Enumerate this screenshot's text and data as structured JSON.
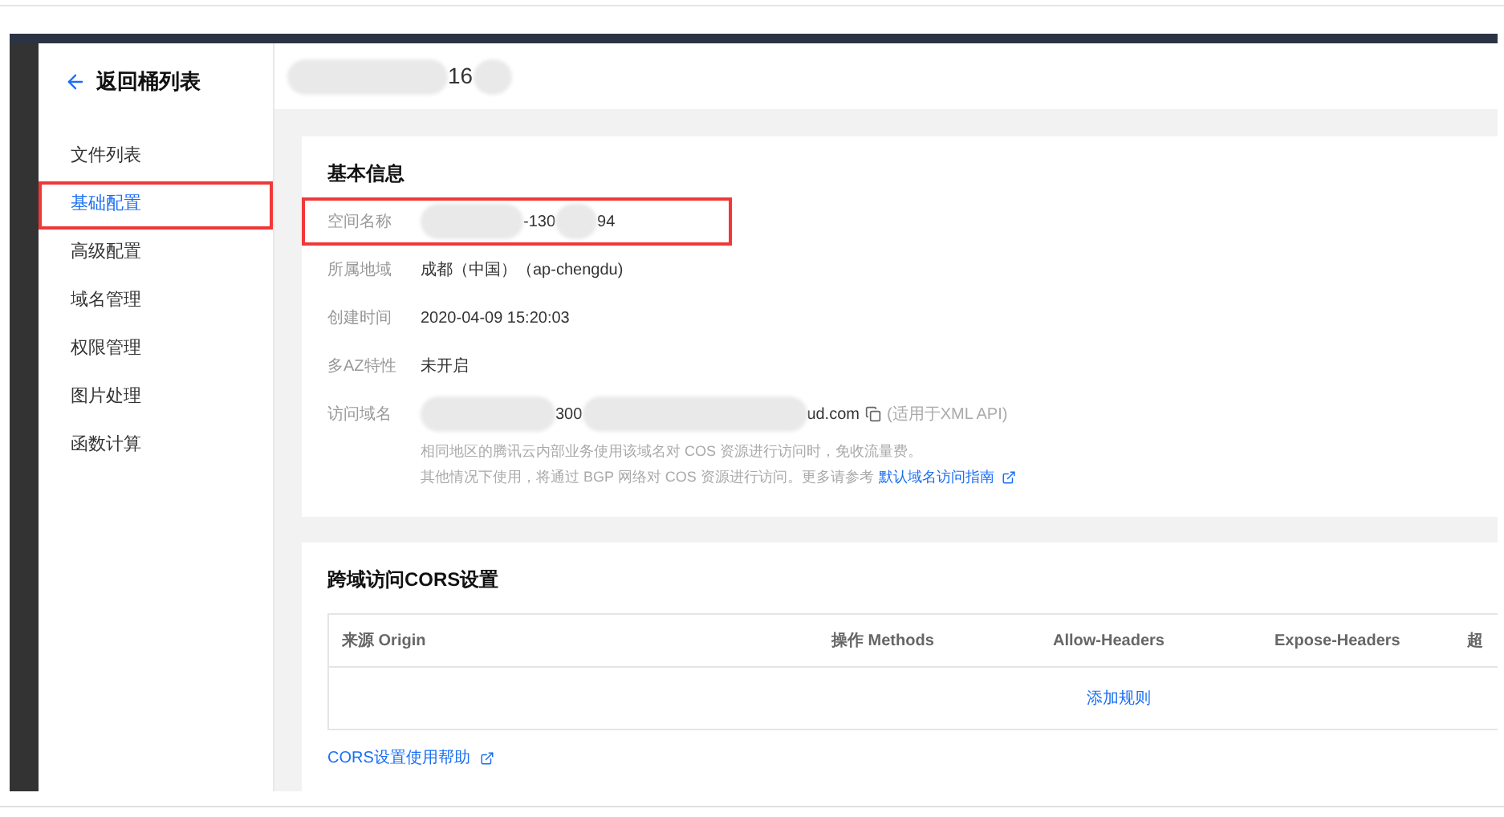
{
  "back_link": "返回桶列表",
  "sidebar": {
    "items": [
      {
        "label": "文件列表",
        "selected": false,
        "highlighted": false
      },
      {
        "label": "基础配置",
        "selected": true,
        "highlighted": true
      },
      {
        "label": "高级配置",
        "selected": false,
        "highlighted": false
      },
      {
        "label": "域名管理",
        "selected": false,
        "highlighted": false
      },
      {
        "label": "权限管理",
        "selected": false,
        "highlighted": false
      },
      {
        "label": "图片处理",
        "selected": false,
        "highlighted": false
      },
      {
        "label": "函数计算",
        "selected": false,
        "highlighted": false
      }
    ]
  },
  "header": {
    "title_visible": "16"
  },
  "basic_info": {
    "title": "基本信息",
    "rows": [
      {
        "label": "空间名称",
        "kind": "redacted",
        "parts": [
          "-130",
          "94"
        ],
        "highlighted": true
      },
      {
        "label": "所属地域",
        "kind": "text",
        "value": "成都（中国）（ap-chengdu)",
        "highlighted": false
      },
      {
        "label": "创建时间",
        "kind": "text",
        "value": "2020-04-09 15:20:03",
        "highlighted": false
      },
      {
        "label": "多AZ特性",
        "kind": "text",
        "value": "未开启",
        "highlighted": false
      },
      {
        "label": "访问域名",
        "kind": "domain",
        "parts": [
          "300",
          "ud.com"
        ],
        "note": "(适用于XML API)",
        "highlighted": false
      }
    ],
    "hint_lines": [
      "相同地区的腾讯云内部业务使用该域名对 COS 资源进行访问时，免收流量费。",
      "其他情况下使用，将通过 BGP 网络对 COS 资源进行访问。更多请参考"
    ],
    "hint_link": "默认域名访问指南"
  },
  "cors": {
    "title": "跨域访问CORS设置",
    "columns": [
      "来源 Origin",
      "操作 Methods",
      "Allow-Headers",
      "Expose-Headers",
      "超"
    ],
    "add_rule": "添加规则",
    "help_link": "CORS设置使用帮助"
  }
}
